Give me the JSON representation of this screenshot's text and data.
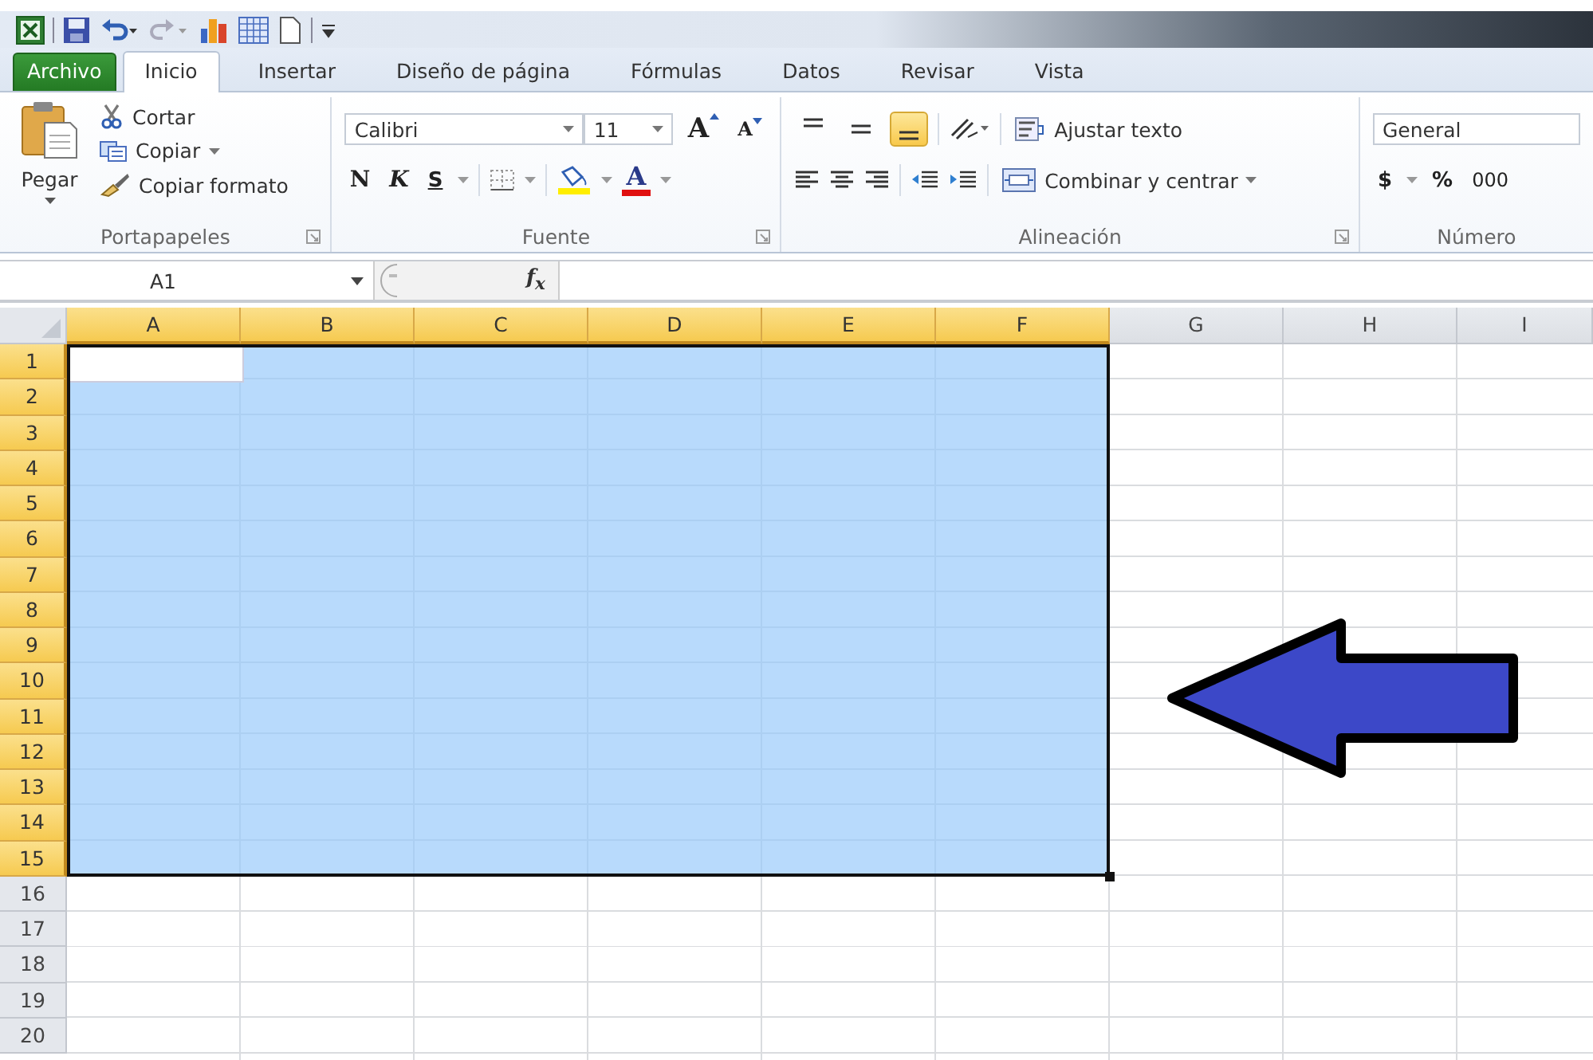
{
  "tabs": [
    {
      "label": "Archivo",
      "kind": "file",
      "selected": false
    },
    {
      "label": "Inicio",
      "kind": "tab",
      "selected": true
    },
    {
      "label": "Insertar",
      "kind": "tab",
      "selected": false
    },
    {
      "label": "Diseño de página",
      "kind": "tab",
      "selected": false
    },
    {
      "label": "Fórmulas",
      "kind": "tab",
      "selected": false
    },
    {
      "label": "Datos",
      "kind": "tab",
      "selected": false
    },
    {
      "label": "Revisar",
      "kind": "tab",
      "selected": false
    },
    {
      "label": "Vista",
      "kind": "tab",
      "selected": false
    }
  ],
  "ribbon": {
    "clipboard": {
      "title": "Portapapeles",
      "paste": "Pegar",
      "cut": "Cortar",
      "copy": "Copiar",
      "format_painter": "Copiar formato"
    },
    "font": {
      "title": "Fuente",
      "font_name": "Calibri",
      "font_size": "11",
      "grow": "A",
      "shrink": "A",
      "bold": "N",
      "italic": "K",
      "underline": "S",
      "font_color": "A"
    },
    "alignment": {
      "title": "Alineación",
      "vertical": [
        {
          "kind": "top",
          "selected": false
        },
        {
          "kind": "middle",
          "selected": false
        },
        {
          "kind": "bottom",
          "selected": true
        }
      ],
      "wrap_text": "Ajustar texto",
      "merge": "Combinar y centrar"
    },
    "number": {
      "title": "Número",
      "format": "General",
      "currency": "$",
      "percent": "%",
      "thousands": "000"
    }
  },
  "formula_bar": {
    "name_box": "A1",
    "function_label": "f$_{x}$"
  },
  "sheet": {
    "columns": [
      {
        "label": "A",
        "selected": true,
        "active": true
      },
      {
        "label": "B",
        "selected": true,
        "active": false
      },
      {
        "label": "C",
        "selected": true,
        "active": false
      },
      {
        "label": "D",
        "selected": true,
        "active": false
      },
      {
        "label": "E",
        "selected": true,
        "active": false
      },
      {
        "label": "F",
        "selected": true,
        "active": false
      },
      {
        "label": "G",
        "selected": false,
        "active": false
      },
      {
        "label": "H",
        "selected": false,
        "active": false
      },
      {
        "label": "I",
        "selected": false,
        "active": false
      }
    ],
    "rows": [
      {
        "label": "1",
        "selected": true,
        "active": true
      },
      {
        "label": "2",
        "selected": true,
        "active": false
      },
      {
        "label": "3",
        "selected": true,
        "active": false
      },
      {
        "label": "4",
        "selected": true,
        "active": false
      },
      {
        "label": "5",
        "selected": true,
        "active": false
      },
      {
        "label": "6",
        "selected": true,
        "active": false
      },
      {
        "label": "7",
        "selected": true,
        "active": false
      },
      {
        "label": "8",
        "selected": true,
        "active": false
      },
      {
        "label": "9",
        "selected": true,
        "active": false
      },
      {
        "label": "10",
        "selected": true,
        "active": false
      },
      {
        "label": "11",
        "selected": true,
        "active": false
      },
      {
        "label": "12",
        "selected": true,
        "active": false
      },
      {
        "label": "13",
        "selected": true,
        "active": false
      },
      {
        "label": "14",
        "selected": true,
        "active": false
      },
      {
        "label": "15",
        "selected": true,
        "active": false
      },
      {
        "label": "16",
        "selected": false,
        "active": false
      },
      {
        "label": "17",
        "selected": false,
        "active": false
      },
      {
        "label": "18",
        "selected": false,
        "active": false
      },
      {
        "label": "19",
        "selected": false,
        "active": false
      },
      {
        "label": "20",
        "selected": false,
        "active": false
      }
    ],
    "shape": {
      "kind": "left-arrow",
      "color": "#3c48c8"
    }
  }
}
